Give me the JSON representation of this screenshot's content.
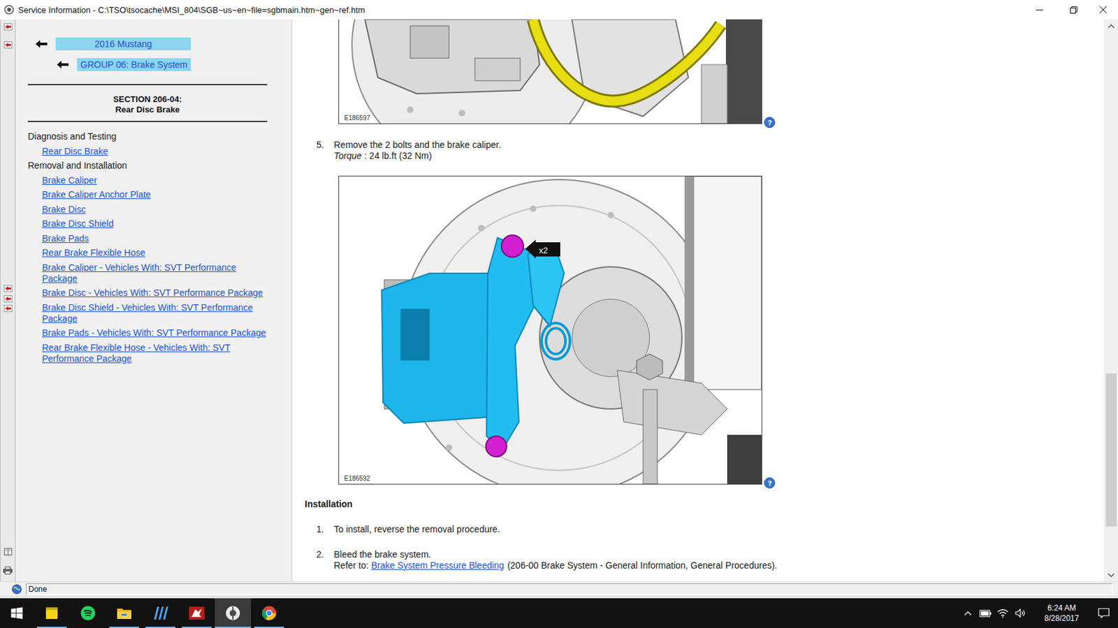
{
  "window": {
    "title": "Service Information - C:\\TSO\\tsocache\\MSI_804\\SGB~us~en~file=sgbmain.htm~gen~ref.htm"
  },
  "breadcrumbs": [
    {
      "label": "2016 Mustang"
    },
    {
      "label": "GROUP 06: Brake System"
    }
  ],
  "section": {
    "number": "SECTION 206-04:",
    "title": "Rear Disc Brake"
  },
  "nav_groups": [
    {
      "heading": "Diagnosis and Testing",
      "links": [
        "Rear Disc Brake"
      ]
    },
    {
      "heading": "Removal and Installation",
      "links": [
        "Brake Caliper",
        "Brake Caliper Anchor Plate",
        "Brake Disc",
        "Brake Disc Shield",
        "Brake Pads",
        "Rear Brake Flexible Hose",
        "Brake Caliper - Vehicles With: SVT Performance Package",
        "Brake Disc - Vehicles With: SVT Performance Package",
        "Brake Disc Shield - Vehicles With: SVT Performance Package",
        "Brake Pads - Vehicles With: SVT Performance Package",
        "Rear Brake Flexible Hose - Vehicles With: SVT Performance Package"
      ]
    }
  ],
  "content": {
    "top_figure": {
      "code": "E186597",
      "help": "?"
    },
    "removal_step": {
      "number": "5.",
      "text": "Remove the 2 bolts and the brake caliper.",
      "torque": {
        "label": "Torque",
        "value": ": 24 lb.ft (32 Nm)"
      }
    },
    "caliper_figure": {
      "code": "E186592",
      "callout": "x2",
      "help": "?"
    },
    "installation": {
      "heading": "Installation",
      "steps": [
        {
          "number": "1.",
          "text": "To install, reverse the removal procedure."
        },
        {
          "number": "2.",
          "text": "Bleed the brake system.",
          "refer": {
            "prefix": "Refer to:",
            "link": "Brake System Pressure Bleeding",
            "suffix": "(206-00 Brake System - General Information, General Procedures)."
          }
        }
      ]
    }
  },
  "scrollbar": {
    "level": 0.89
  },
  "status_bar": {
    "text": "Done"
  },
  "taskbar": {
    "apps": [
      {
        "kind": "notes",
        "open": true,
        "selected": false
      },
      {
        "kind": "spotify",
        "open": false,
        "selected": false
      },
      {
        "kind": "explorer",
        "open": true,
        "selected": false
      },
      {
        "kind": "editor",
        "open": true,
        "selected": false
      },
      {
        "kind": "game",
        "open": true,
        "selected": false
      },
      {
        "kind": "service",
        "open": true,
        "selected": true
      },
      {
        "kind": "chrome",
        "open": true,
        "selected": false
      }
    ],
    "time": "6:24 AM",
    "date": "8/28/2017"
  }
}
